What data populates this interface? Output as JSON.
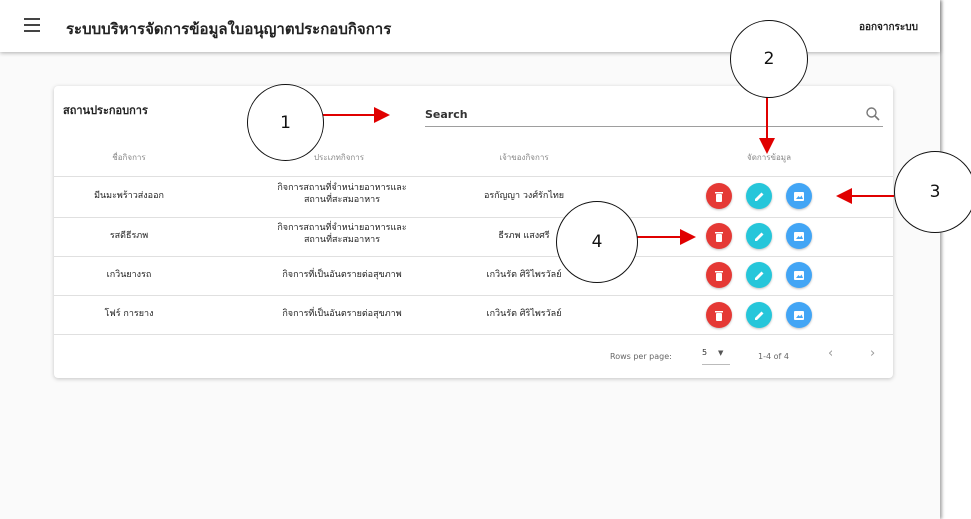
{
  "appbar": {
    "title": "ระบบบริหารจัดการข้อมูลใบอนุญาตประกอบกิจการ",
    "logout_label": "ออกจากระบบ"
  },
  "card": {
    "title": "สถานประกอบการ",
    "search_placeholder": "Search",
    "columns": [
      "ชื่อกิจการ",
      "ประเภทกิจการ",
      "เจ้าของกิจการ",
      "จัดการข้อมูล"
    ],
    "rows": [
      {
        "name": "มีนมะพร้าวส่งออก",
        "type": "กิจการสถานที่จำหน่ายอาหารและสถานที่สะสมอาหาร",
        "owner": "อรกัญญา วงศ์รักไทย"
      },
      {
        "name": "รสดีธีรภพ",
        "type": "กิจการสถานที่จำหน่ายอาหารและสถานที่สะสมอาหาร",
        "owner": "ธีรภพ แสงศรี"
      },
      {
        "name": "เกวินยางรถ",
        "type": "กิจการที่เป็นอันตรายต่อสุขภาพ",
        "owner": "เกวินรัต ศิริไพรวัลย์"
      },
      {
        "name": "โฟร์ การยาง",
        "type": "กิจการที่เป็นอันตรายต่อสุขภาพ",
        "owner": "เกวินรัต ศิริไพรวัลย์"
      }
    ]
  },
  "pagination": {
    "rows_per_page_label": "Rows per page:",
    "rows_per_page_value": "5",
    "range_text": "1-4 of 4"
  },
  "callouts": [
    "1",
    "2",
    "3",
    "4"
  ],
  "colors": {
    "delete": "#e53935",
    "edit": "#26c6da",
    "info": "#42a5f5",
    "arrow": "#e00000"
  }
}
